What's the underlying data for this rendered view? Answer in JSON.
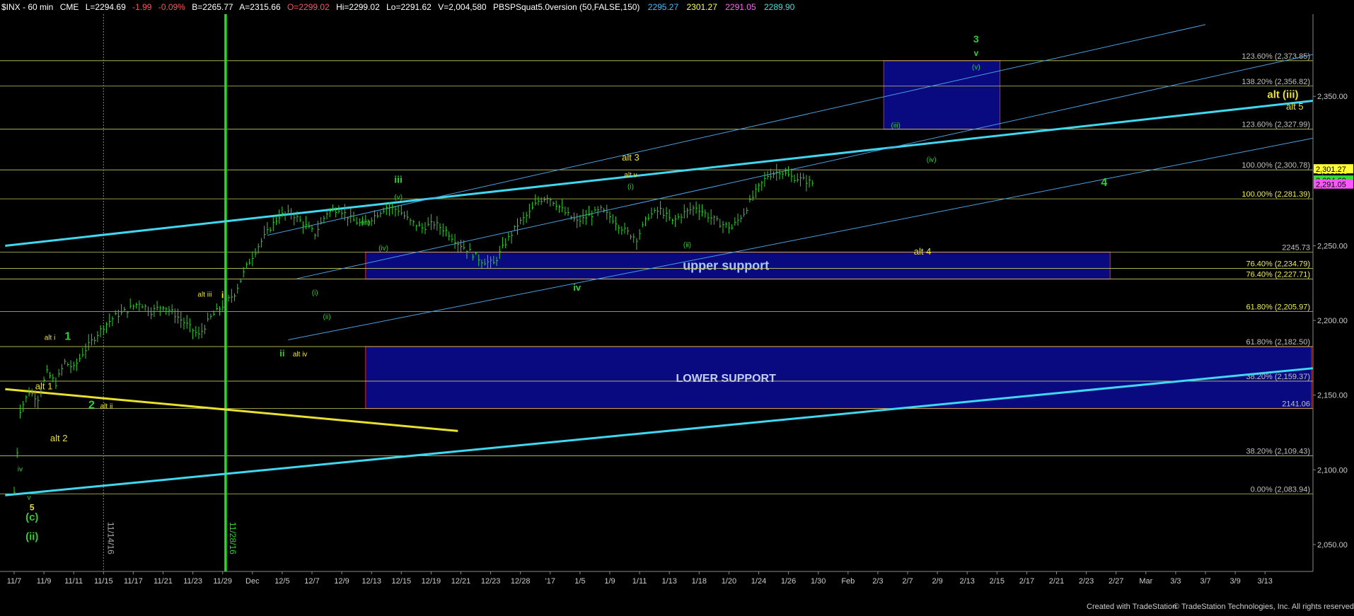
{
  "header": {
    "symbol": "$INX - 60 min",
    "exchange": "CME",
    "last": "L=2294.69",
    "change": "-1.99",
    "pct": "-0.09%",
    "bid": "B=2265.77",
    "ask": "A=2315.66",
    "open": "O=2299.02",
    "high": "Hi=2299.02",
    "low": "Lo=2291.62",
    "volume": "V=2,004,580",
    "study": "PBSPSquat5.0version (50,FALSE,150)",
    "study_values": [
      {
        "text": "2295.27",
        "color": "#40c0ff"
      },
      {
        "text": "2301.27",
        "color": "#ffff66"
      },
      {
        "text": "2291.05",
        "color": "#ff66ff"
      },
      {
        "text": "2289.90",
        "color": "#40e0e0"
      }
    ]
  },
  "footer": {
    "left": "Created with TradeStation",
    "right": "© TradeStation Technologies, Inc. All rights reserved."
  },
  "colors": {
    "background": "#000000",
    "fib_line": "#c8c860",
    "trend_cyan": "#40d8f0",
    "channel_blue": "#4aa0e0",
    "support_box": "#0a0a80",
    "box_border": "#c02020",
    "wave_green": "#33cc33",
    "wave_yellow": "#e8e030",
    "vline_green": "#22dd22",
    "bars": "#33cc33"
  },
  "chart_data": {
    "type": "line",
    "title": "$INX - 60 min",
    "ylim": [
      2032,
      2405
    ],
    "y_ticks": [
      "2,050.00",
      "2,100.00",
      "2,150.00",
      "2,200.00",
      "2,250.00",
      "2,300.00",
      "2,350.00"
    ],
    "y_tick_values": [
      2050,
      2100,
      2150,
      2200,
      2250,
      2300,
      2350
    ],
    "x_ticks": [
      "11/7",
      "11/9",
      "11/11",
      "11/15",
      "11/17",
      "11/21",
      "11/23",
      "11/29",
      "Dec",
      "12/5",
      "12/7",
      "12/9",
      "12/13",
      "12/15",
      "12/19",
      "12/21",
      "12/23",
      "12/28",
      "'17",
      "1/5",
      "1/9",
      "1/11",
      "1/13",
      "1/18",
      "1/20",
      "1/24",
      "1/26",
      "1/30",
      "Feb",
      "2/3",
      "2/7",
      "2/9",
      "2/13",
      "2/15",
      "2/17",
      "2/21",
      "2/23",
      "2/27",
      "Mar",
      "3/3",
      "3/7",
      "3/9",
      "3/13"
    ],
    "x_tick_index": [
      0,
      1,
      2,
      3,
      4,
      5,
      6,
      7,
      8,
      9,
      10,
      11,
      12,
      13,
      14,
      15,
      16,
      17,
      18,
      19,
      20,
      21,
      22,
      23,
      24,
      25,
      26,
      27,
      28,
      29,
      30,
      31,
      32,
      33,
      34,
      35,
      36,
      37,
      38,
      39,
      40,
      41,
      42
    ],
    "series": [
      {
        "values_t": [
          0,
          0.2,
          0.5,
          0.8,
          1.1,
          1.4,
          1.7,
          2.0,
          2.3,
          2.6,
          3.0,
          3.4,
          3.8,
          4.2,
          4.6,
          5.0,
          5.4,
          5.8,
          6.2,
          6.6,
          7.0,
          7.4,
          7.8,
          8.2,
          8.6,
          8.9,
          9.3,
          9.7,
          10.1,
          10.5,
          10.9,
          11.3,
          11.7,
          12.1,
          12.5,
          12.9,
          13.3,
          13.7,
          14.1,
          14.5,
          14.9,
          15.3,
          15.7,
          16.1,
          16.5,
          16.9,
          17.3,
          17.6,
          17.9,
          18.2,
          18.5,
          18.9,
          19.3,
          19.7,
          20.1,
          20.5,
          20.9,
          21.3,
          21.7,
          22.1,
          22.5,
          22.9,
          23.3,
          23.7,
          24.1,
          24.5,
          24.9,
          25.3,
          25.7,
          26.1,
          26.5,
          26.8
        ],
        "values": [
          2085,
          2140,
          2152,
          2148,
          2165,
          2158,
          2172,
          2168,
          2178,
          2186,
          2196,
          2203,
          2207,
          2212,
          2206,
          2210,
          2204,
          2197,
          2190,
          2202,
          2210,
          2218,
          2236,
          2250,
          2262,
          2270,
          2272,
          2265,
          2258,
          2272,
          2275,
          2268,
          2264,
          2270,
          2276,
          2274,
          2266,
          2262,
          2265,
          2260,
          2252,
          2246,
          2240,
          2238,
          2252,
          2264,
          2272,
          2280,
          2283,
          2278,
          2272,
          2266,
          2270,
          2274,
          2268,
          2260,
          2255,
          2270,
          2274,
          2266,
          2272,
          2276,
          2270,
          2265,
          2262,
          2272,
          2286,
          2297,
          2300,
          2296,
          2294,
          2292
        ]
      }
    ],
    "fib_levels": [
      {
        "pct": "123.60%",
        "value": 2373.85,
        "label": "123.60% (2,373.85)"
      },
      {
        "pct": "138.20%",
        "value": 2356.82,
        "label": "138.20% (2,356.82)"
      },
      {
        "pct": "123.60%",
        "value": 2327.99,
        "label": "123.60% (2,327.99)"
      },
      {
        "pct": "100.00%",
        "value": 2300.78,
        "label": "100.00% (2,300.78)"
      },
      {
        "pct": "100.00%",
        "value": 2281.39,
        "label": "100.00% (2,281.39)"
      },
      {
        "pct": "",
        "value": 2245.73,
        "label": "2245.73"
      },
      {
        "pct": "76.40%",
        "value": 2234.79,
        "label": "76.40% (2,234.79)"
      },
      {
        "pct": "76.40%",
        "value": 2227.71,
        "label": "76.40% (2,227.71)"
      },
      {
        "pct": "61.80%",
        "value": 2205.97,
        "label": "61.80% (2,205.97)"
      },
      {
        "pct": "61.80%",
        "value": 2182.5,
        "label": "61.80% (2,182.50)"
      },
      {
        "pct": "38.20%",
        "value": 2159.37,
        "label": "38.20% (2,159.37)"
      },
      {
        "pct": "",
        "value": 2141.06,
        "label": "2141.06"
      },
      {
        "pct": "38.20%",
        "value": 2109.43,
        "label": "38.20% (2,109.43)"
      },
      {
        "pct": "0.00%",
        "value": 2083.94,
        "label": "0.00% (2,083.94)"
      }
    ],
    "price_tags": [
      {
        "text": "2,301.27",
        "value": 2301.27,
        "bg": "#ffff33"
      },
      {
        "text": "2,294.69",
        "value": 2294.69,
        "bg": "#33dd33"
      },
      {
        "text": "2,291.05",
        "value": 2291.05,
        "bg": "#ff55ff"
      }
    ],
    "zones": [
      {
        "label": "upper support",
        "t0": 11.8,
        "t1": 36.8,
        "y0": 2227.71,
        "y1": 2245.73
      },
      {
        "label": "LOWER SUPPORT",
        "t0": 11.8,
        "t1": 44.2,
        "y0": 2141.06,
        "y1": 2182.5
      },
      {
        "label": "",
        "t0": 29.2,
        "t1": 33.1,
        "y0": 2327.99,
        "y1": 2373.85
      }
    ],
    "trendlines": [
      {
        "kind": "cyan",
        "t0": -0.3,
        "y0": 2250,
        "t1": 44.2,
        "y1": 2347
      },
      {
        "kind": "cyan",
        "t0": -0.3,
        "y0": 2083,
        "t1": 44.2,
        "y1": 2168
      },
      {
        "kind": "yellow",
        "t0": -0.3,
        "y0": 2154,
        "t1": 14.9,
        "y1": 2126
      },
      {
        "kind": "blue",
        "t0": 8.5,
        "y0": 2257,
        "t1": 40.0,
        "y1": 2398
      },
      {
        "kind": "blue",
        "t0": 9.2,
        "y0": 2187,
        "t1": 44.2,
        "y1": 2322
      },
      {
        "kind": "blue",
        "t0": 9.5,
        "y0": 2228,
        "t1": 44.2,
        "y1": 2378
      }
    ],
    "vlines": [
      {
        "t": 7.1,
        "label": "11/28/16",
        "kind": "green"
      },
      {
        "t": 3.0,
        "label": "11/14/16",
        "kind": "dotted"
      }
    ],
    "annotations": [
      {
        "text": "3",
        "t": 32.3,
        "y": 2386,
        "color": "green",
        "size": 14,
        "bold": true
      },
      {
        "text": "v",
        "t": 32.3,
        "y": 2377,
        "color": "green",
        "size": 12,
        "bold": true
      },
      {
        "text": "(v)",
        "t": 32.3,
        "y": 2368,
        "color": "green",
        "size": 10,
        "bold": false
      },
      {
        "text": "(iii)",
        "t": 29.6,
        "y": 2329,
        "color": "green",
        "size": 10,
        "bold": false
      },
      {
        "text": "alt (iii)",
        "t": 42.6,
        "y": 2349,
        "color": "yellow",
        "size": 15,
        "bold": true
      },
      {
        "text": "alt 5",
        "t": 43.0,
        "y": 2341,
        "color": "yellow",
        "size": 13,
        "bold": false
      },
      {
        "text": "(iv)",
        "t": 30.8,
        "y": 2306,
        "color": "green",
        "size": 10,
        "bold": false
      },
      {
        "text": "4",
        "t": 36.6,
        "y": 2290,
        "color": "green",
        "size": 16,
        "bold": true
      },
      {
        "text": "alt 3",
        "t": 20.7,
        "y": 2307,
        "color": "yellow",
        "size": 13,
        "bold": false
      },
      {
        "text": "alt v",
        "t": 20.7,
        "y": 2296,
        "color": "yellow",
        "size": 10,
        "bold": false
      },
      {
        "text": "(i)",
        "t": 20.7,
        "y": 2288,
        "color": "green",
        "size": 10,
        "bold": false
      },
      {
        "text": "iii",
        "t": 12.9,
        "y": 2292,
        "color": "green",
        "size": 14,
        "bold": true
      },
      {
        "text": "(v)",
        "t": 12.9,
        "y": 2281,
        "color": "green",
        "size": 10,
        "bold": false
      },
      {
        "text": "(iii)",
        "t": 11.8,
        "y": 2264,
        "color": "green",
        "size": 10,
        "bold": false
      },
      {
        "text": "(iv)",
        "t": 12.4,
        "y": 2247,
        "color": "green",
        "size": 10,
        "bold": false
      },
      {
        "text": "(ii)",
        "t": 22.6,
        "y": 2249,
        "color": "green",
        "size": 10,
        "bold": false
      },
      {
        "text": "alt 4",
        "t": 30.5,
        "y": 2244,
        "color": "yellow",
        "size": 13,
        "bold": false
      },
      {
        "text": "iv",
        "t": 18.9,
        "y": 2220,
        "color": "green",
        "size": 13,
        "bold": true
      },
      {
        "text": "(i)",
        "t": 10.1,
        "y": 2217,
        "color": "green",
        "size": 10,
        "bold": false
      },
      {
        "text": "(ii)",
        "t": 10.5,
        "y": 2201,
        "color": "green",
        "size": 10,
        "bold": false
      },
      {
        "text": "alt iii",
        "t": 6.4,
        "y": 2216,
        "color": "yellow",
        "size": 10,
        "bold": false
      },
      {
        "text": "i",
        "t": 7.0,
        "y": 2215,
        "color": "yellow",
        "size": 13,
        "bold": true
      },
      {
        "text": "alt i",
        "t": 1.2,
        "y": 2187,
        "color": "yellow",
        "size": 10,
        "bold": false
      },
      {
        "text": "1",
        "t": 1.8,
        "y": 2187,
        "color": "green",
        "size": 16,
        "bold": true
      },
      {
        "text": "ii",
        "t": 9.0,
        "y": 2176,
        "color": "green",
        "size": 13,
        "bold": true
      },
      {
        "text": "alt iv",
        "t": 9.6,
        "y": 2176,
        "color": "yellow",
        "size": 10,
        "bold": false
      },
      {
        "text": "alt 1",
        "t": 1.0,
        "y": 2154,
        "color": "yellow",
        "size": 13,
        "bold": false
      },
      {
        "text": "2",
        "t": 2.6,
        "y": 2141,
        "color": "green",
        "size": 16,
        "bold": true
      },
      {
        "text": "alt ii",
        "t": 3.1,
        "y": 2141,
        "color": "yellow",
        "size": 10,
        "bold": false
      },
      {
        "text": "alt 2",
        "t": 1.5,
        "y": 2119,
        "color": "yellow",
        "size": 13,
        "bold": false
      },
      {
        "text": "iv",
        "t": 0.2,
        "y": 2099,
        "color": "green",
        "size": 10,
        "bold": false
      },
      {
        "text": "v",
        "t": 0.5,
        "y": 2080,
        "color": "green",
        "size": 10,
        "bold": false
      },
      {
        "text": "5",
        "t": 0.6,
        "y": 2073,
        "color": "yellow",
        "size": 12,
        "bold": true
      },
      {
        "text": "(c)",
        "t": 0.6,
        "y": 2066,
        "color": "green",
        "size": 15,
        "bold": true
      },
      {
        "text": "(ii)",
        "t": 0.6,
        "y": 2053,
        "color": "green",
        "size": 15,
        "bold": true
      }
    ]
  }
}
